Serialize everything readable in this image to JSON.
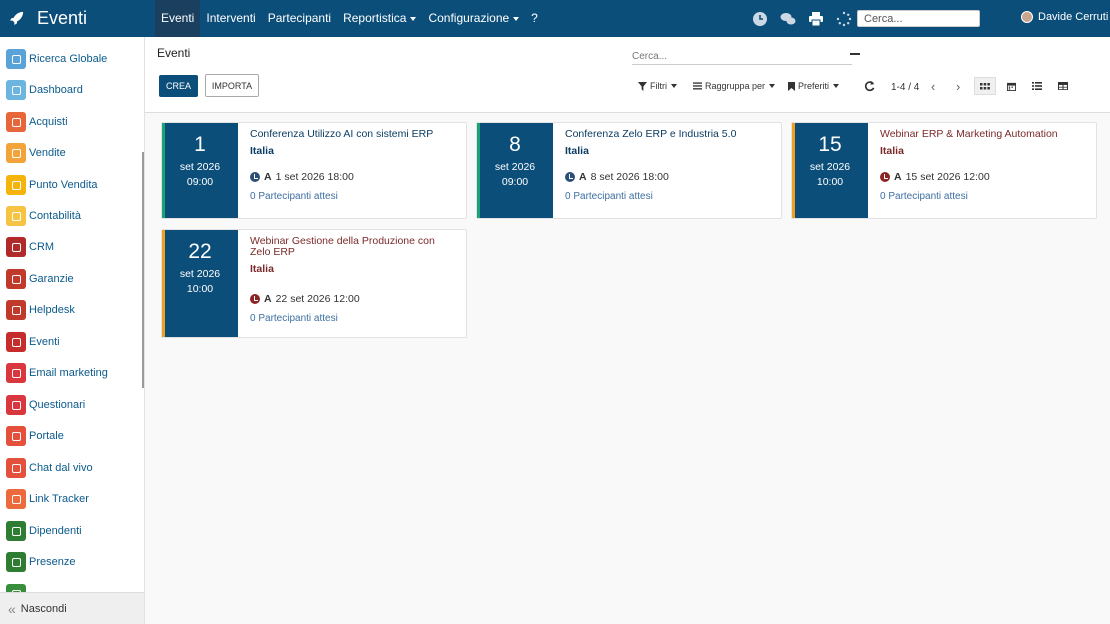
{
  "app": {
    "title": "Eventi"
  },
  "topmenu": [
    {
      "label": "Eventi",
      "active": true,
      "dropdown": false
    },
    {
      "label": "Interventi",
      "active": false,
      "dropdown": false
    },
    {
      "label": "Partecipanti",
      "active": false,
      "dropdown": false
    },
    {
      "label": "Reportistica",
      "active": false,
      "dropdown": true
    },
    {
      "label": "Configurazione",
      "active": false,
      "dropdown": true
    },
    {
      "label": "?",
      "active": false,
      "dropdown": false
    }
  ],
  "systray": {
    "search_placeholder": "Cerca...",
    "user_name": "Davide Cerruti"
  },
  "sidebar": {
    "items": [
      {
        "label": "Ricerca Globale",
        "color": "#5aa3d8",
        "icon": "search-icon"
      },
      {
        "label": "Dashboard",
        "color": "#6bb5e0",
        "icon": "dashboard-icon"
      },
      {
        "label": "Acquisti",
        "color": "#e8673a",
        "icon": "purchase-icon"
      },
      {
        "label": "Vendite",
        "color": "#f2a33a",
        "icon": "chart-line-icon"
      },
      {
        "label": "Punto Vendita",
        "color": "#f5b40b",
        "icon": "pos-icon"
      },
      {
        "label": "Contabilità",
        "color": "#f6c343",
        "icon": "accounting-icon"
      },
      {
        "label": "CRM",
        "color": "#b02a2a",
        "icon": "handshake-icon"
      },
      {
        "label": "Garanzie",
        "color": "#c0392b",
        "icon": "shield-icon"
      },
      {
        "label": "Helpdesk",
        "color": "#c0392b",
        "icon": "headset-icon"
      },
      {
        "label": "Eventi",
        "color": "#c72c2c",
        "icon": "ticket-icon"
      },
      {
        "label": "Email marketing",
        "color": "#d9363e",
        "icon": "paper-plane-icon"
      },
      {
        "label": "Questionari",
        "color": "#d9363e",
        "icon": "survey-icon"
      },
      {
        "label": "Portale",
        "color": "#e4503b",
        "icon": "globe-icon"
      },
      {
        "label": "Chat dal vivo",
        "color": "#e4503b",
        "icon": "chat-icon"
      },
      {
        "label": "Link Tracker",
        "color": "#ec6a3c",
        "icon": "link-icon"
      },
      {
        "label": "Dipendenti",
        "color": "#2e7d32",
        "icon": "users-icon"
      },
      {
        "label": "Presenze",
        "color": "#2e7d32",
        "icon": "user-check-icon"
      },
      {
        "label": "",
        "color": "#388e3c",
        "icon": "app-icon"
      }
    ],
    "hide_label": "Nascondi"
  },
  "control_panel": {
    "title": "Eventi",
    "search_placeholder": "Cerca...",
    "create_label": "CREA",
    "import_label": "IMPORTA",
    "filters_label": "Filtri",
    "groupby_label": "Raggruppa per",
    "favorites_label": "Preferiti",
    "pager": "1-4 / 4"
  },
  "events": [
    {
      "day": "1",
      "month_year": "set 2026",
      "time": "09:00",
      "title": "Conferenza Utilizzo AI con sistemi ERP",
      "country": "Italia",
      "end_prefix": "A",
      "end": "1 set 2026 18:00",
      "participants": "0 Partecipanti attesi",
      "stripe": "#1aa37a",
      "text_color": "#0c3d63",
      "icon_color": "#2c4f7a"
    },
    {
      "day": "8",
      "month_year": "set 2026",
      "time": "09:00",
      "title": "Conferenza Zelo ERP e Industria 5.0",
      "country": "Italia",
      "end_prefix": "A",
      "end": "8 set 2026 18:00",
      "participants": "0 Partecipanti attesi",
      "stripe": "#1aa37a",
      "text_color": "#0c3d63",
      "icon_color": "#2c4f7a"
    },
    {
      "day": "15",
      "month_year": "set 2026",
      "time": "10:00",
      "title": "Webinar ERP & Marketing Automation",
      "country": "Italia",
      "end_prefix": "A",
      "end": "15 set 2026 12:00",
      "participants": "0 Partecipanti attesi",
      "stripe": "#f0a020",
      "text_color": "#7a2a2a",
      "icon_color": "#8b2525"
    },
    {
      "day": "22",
      "month_year": "set 2026",
      "time": "10:00",
      "title": "Webinar Gestione della Produzione con Zelo ERP",
      "country": "Italia",
      "end_prefix": "A",
      "end": "22 set 2026 12:00",
      "participants": "0 Partecipanti attesi",
      "stripe": "#f0a020",
      "text_color": "#7a2a2a",
      "icon_color": "#8b2525"
    }
  ]
}
